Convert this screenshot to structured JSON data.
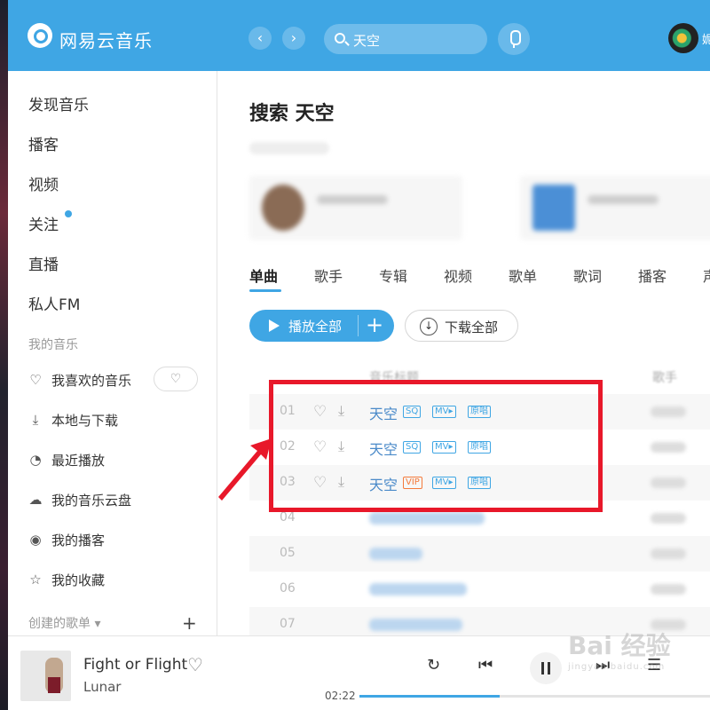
{
  "header": {
    "app_name": "网易云音乐",
    "back_icon": "chevron-left-icon",
    "forward_icon": "chevron-right-icon",
    "search_value": "天空",
    "user_name_partial": "妮"
  },
  "sidebar": {
    "nav": [
      {
        "label": "发现音乐"
      },
      {
        "label": "播客"
      },
      {
        "label": "视频"
      },
      {
        "label": "关注"
      },
      {
        "label": "直播"
      },
      {
        "label": "私人FM"
      }
    ],
    "my_music_title": "我的音乐",
    "my_music": [
      {
        "label": "我喜欢的音乐",
        "icon": "heart-icon"
      },
      {
        "label": "本地与下载",
        "icon": "download-icon"
      },
      {
        "label": "最近播放",
        "icon": "history-icon"
      },
      {
        "label": "我的音乐云盘",
        "icon": "cloud-icon"
      },
      {
        "label": "我的播客",
        "icon": "podcast-icon"
      },
      {
        "label": "我的收藏",
        "icon": "collection-icon"
      }
    ],
    "created_title": "创建的歌单 ▾",
    "add_symbol": "+"
  },
  "main": {
    "title": "搜索 天空",
    "tabs": [
      "单曲",
      "歌手",
      "专辑",
      "视频",
      "歌单",
      "歌词",
      "播客",
      "声"
    ],
    "play_all_label": "播放全部",
    "play_all_plus": "+",
    "download_all_label": "下载全部",
    "columns": {
      "title": "音乐标题",
      "artist": "歌手"
    },
    "rows": [
      {
        "num": "01",
        "title": "天空",
        "tags": [
          "SQ",
          "MV▸",
          "原唱"
        ],
        "tag_colors": [
          "blue",
          "blue",
          "blue"
        ]
      },
      {
        "num": "02",
        "title": "天空",
        "tags": [
          "SQ",
          "MV▸",
          "原唱"
        ],
        "tag_colors": [
          "blue",
          "blue",
          "blue"
        ]
      },
      {
        "num": "03",
        "title": "天空",
        "tags": [
          "VIP",
          "MV▸",
          "原唱"
        ],
        "tag_colors": [
          "orange",
          "blue",
          "blue"
        ]
      },
      {
        "num": "04"
      },
      {
        "num": "05"
      },
      {
        "num": "06"
      },
      {
        "num": "07"
      }
    ]
  },
  "player": {
    "song_title": "Fight or Flight",
    "artist": "Lunar",
    "current_time": "02:22",
    "progress_percent": 40
  },
  "watermark": {
    "main": "Bai 经验",
    "sub": "jingyan.baidu.com"
  },
  "colors": {
    "accent": "#3fa6e4",
    "highlight": "#e8182a",
    "vip": "#f47a3b"
  }
}
